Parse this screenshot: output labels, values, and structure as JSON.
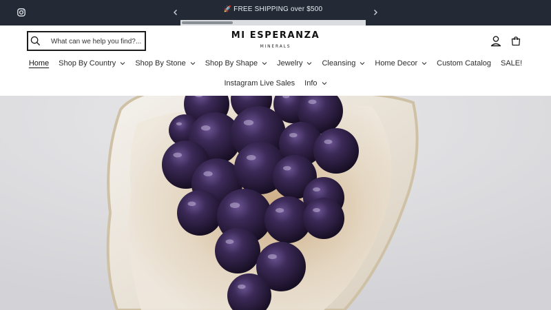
{
  "announcement": {
    "icon": "rocket-icon",
    "text": "FREE SHIPPING over $500",
    "progress": 0.28
  },
  "header": {
    "search": {
      "placeholder": "What can we help you find?..."
    },
    "logo": {
      "name": "MI ESPERANZA",
      "tagline": "MINERALS"
    }
  },
  "nav": {
    "row1": [
      {
        "label": "Home",
        "active": true,
        "dropdown": false
      },
      {
        "label": "Shop By Country",
        "dropdown": true
      },
      {
        "label": "Shop By Stone",
        "dropdown": true
      },
      {
        "label": "Shop By Shape",
        "dropdown": true
      },
      {
        "label": "Jewelry",
        "dropdown": true
      },
      {
        "label": "Cleansing",
        "dropdown": true
      },
      {
        "label": "Home Decor",
        "dropdown": true
      },
      {
        "label": "Custom Catalog",
        "dropdown": false
      },
      {
        "label": "SALE!",
        "dropdown": false
      }
    ],
    "row2": [
      {
        "label": "Instagram Live Sales",
        "dropdown": false
      },
      {
        "label": "Info",
        "dropdown": true
      }
    ]
  },
  "hero": {
    "image": "amethyst-spheres-in-shell-bowl",
    "colors": {
      "background": "#dcdcdf",
      "shell": "#eee7dc",
      "stone": "#2a1b3c"
    }
  },
  "colors": {
    "announcement_bg": "#232a36",
    "text": "#2b2b2b"
  }
}
